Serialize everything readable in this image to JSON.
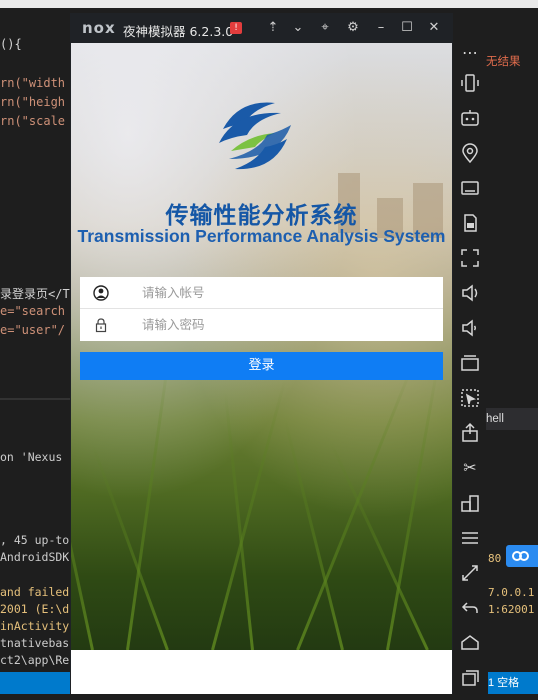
{
  "ide": {
    "code_lines": [
      {
        "pre": "",
        "text": "(){",
        "post": ""
      },
      {
        "pre": "",
        "text": "rn(\"width",
        "post": ""
      },
      {
        "pre": "",
        "text": "rn(\"heigh",
        "post": ""
      },
      {
        "pre": "",
        "text": "rn(\"scale",
        "post": ""
      },
      {
        "text": "录登录页</T"
      },
      {
        "text": "e=\"search"
      },
      {
        "text": "e=\"user\"/"
      }
    ],
    "terminal_lines": [
      "on 'Nexus",
      ", 45 up-to",
      "AndroidSDK",
      "and failed",
      "2001 (E:\\d",
      "inActivity",
      "tnativebas",
      "ct2\\app\\Re"
    ],
    "right_panel_label": "无结果",
    "right_shell_label": "hell",
    "right_terminal": [
      "80",
      "7.0.0.1",
      "1:62001"
    ],
    "status_right": "1    空格"
  },
  "emulator": {
    "logo_text": "nox",
    "title": "夜神模拟器 6.2.3.0",
    "update_badge": "!",
    "titlebar_buttons": {
      "pin": "⇡",
      "dropdown": "⌄",
      "sticky": "⌖",
      "settings": "⚙",
      "minimize": "–",
      "maximize": "☐",
      "close": "✕"
    }
  },
  "app": {
    "title": "传输性能分析系统",
    "subtitle": "Transmission Performance Analysis System",
    "account_placeholder": "请输入帐号",
    "password_placeholder": "请输入密码",
    "login_label": "登录",
    "brand_color": "#1557a6",
    "accent_color": "#0f7df4"
  },
  "toolbar": {
    "items": [
      "more-icon",
      "shake-icon",
      "robot-icon",
      "location-icon",
      "keyboard-icon",
      "sd-card-icon",
      "fullscreen-icon",
      "volume-up-icon",
      "volume-down-icon",
      "screenshot-icon",
      "multi-instance-icon",
      "apk-install-icon",
      "cut-icon",
      "layout-icon",
      "menu-icon",
      "resize-icon",
      "back-icon",
      "home-icon",
      "recent-icon"
    ]
  }
}
